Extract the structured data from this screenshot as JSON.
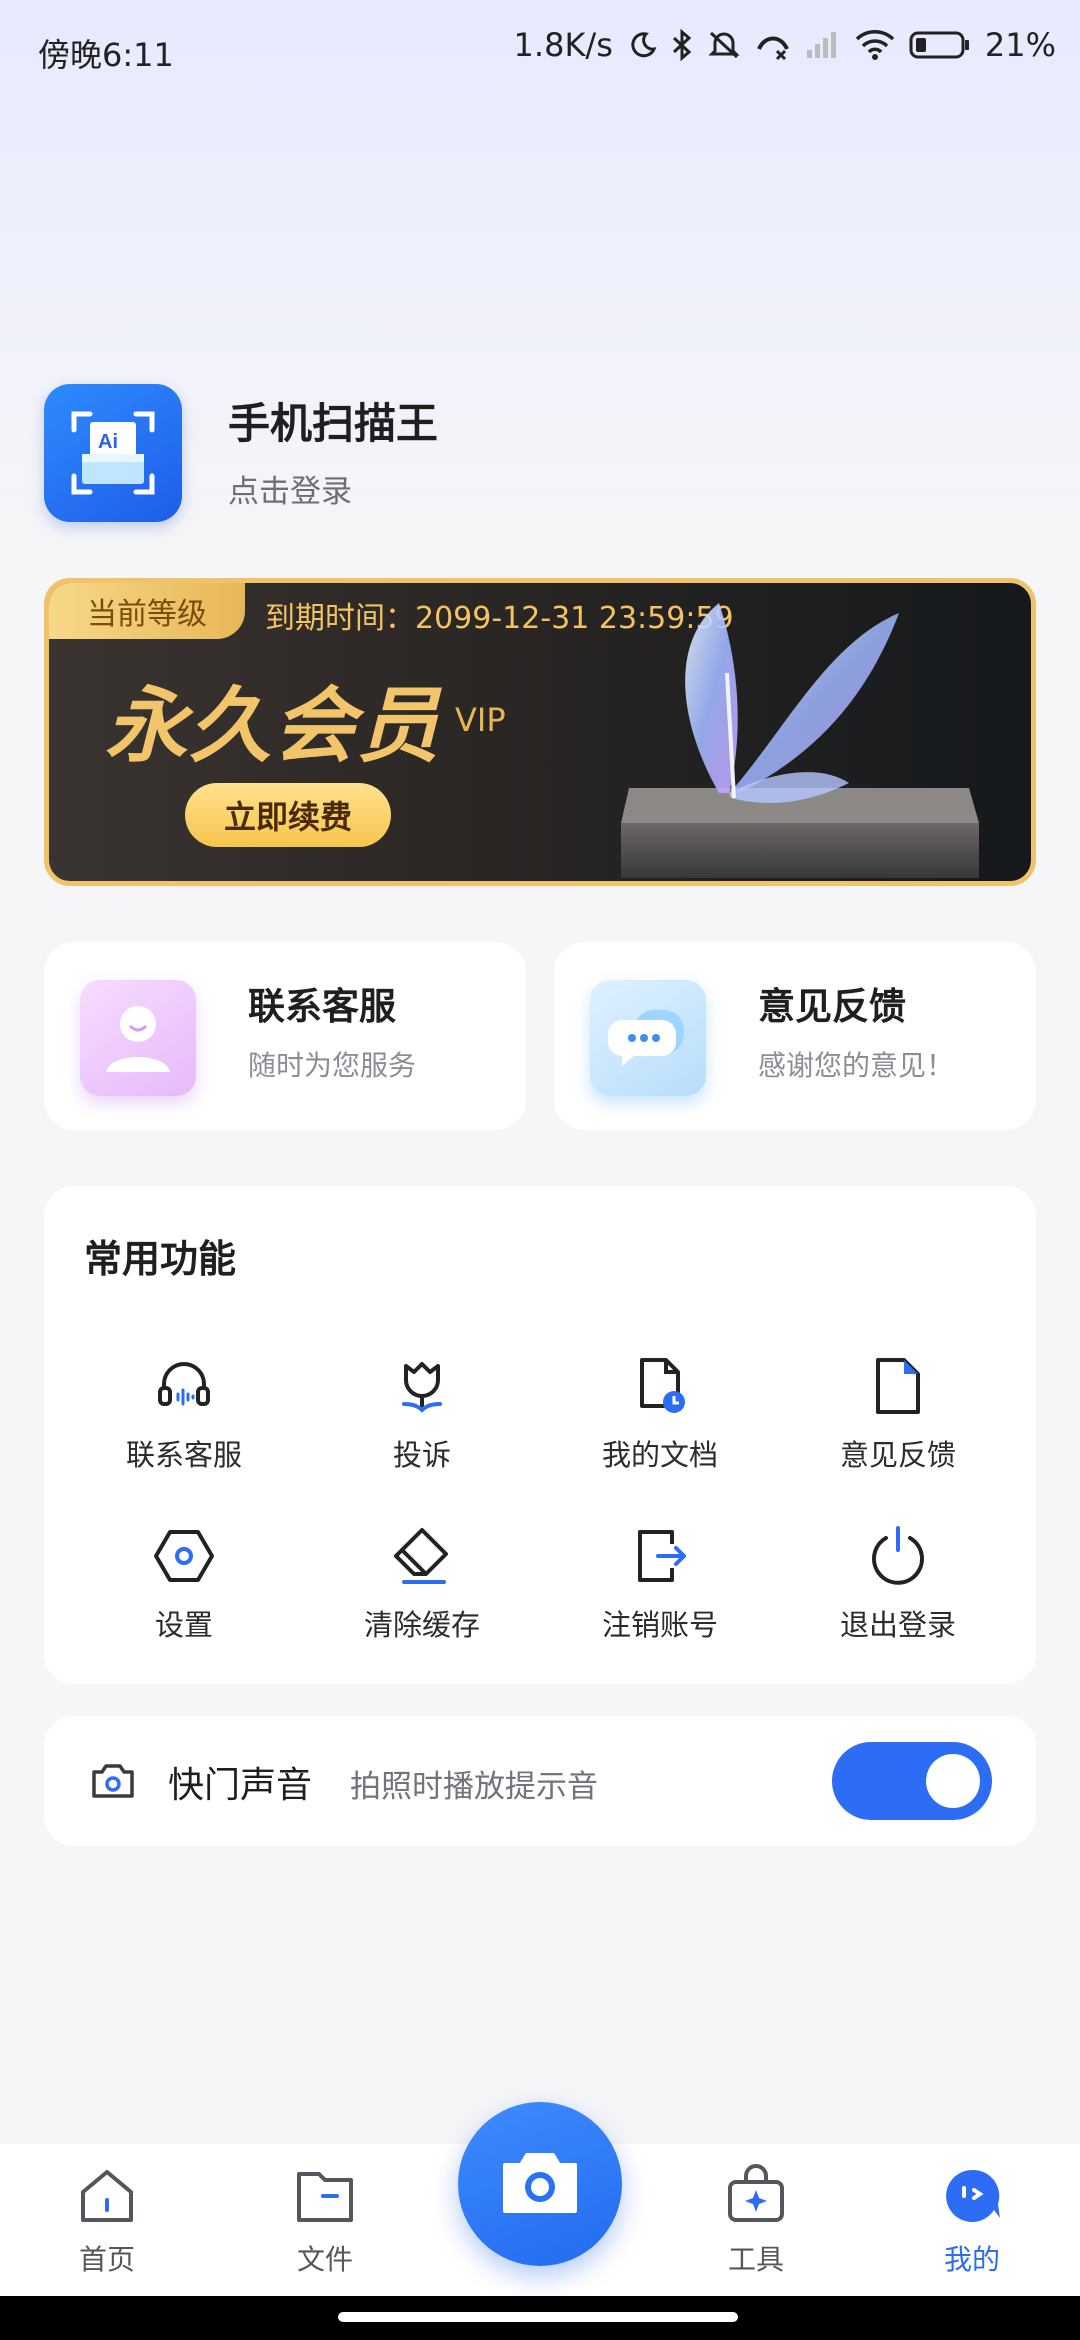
{
  "status_bar": {
    "time": "傍晚6:11",
    "network_speed": "1.8K/s",
    "battery": "21%",
    "icons": [
      "moon-icon",
      "bluetooth-icon",
      "mute-bell-icon",
      "call-icon",
      "signal-icon",
      "wifi-icon",
      "battery-icon"
    ]
  },
  "profile": {
    "app_name": "手机扫描王",
    "login_prompt": "点击登录",
    "logo_text": "Ai"
  },
  "vip_banner": {
    "tag": "当前等级",
    "expiry": "到期时间：2099-12-31 23:59:59",
    "title": "永久会员",
    "suffix": "VIP",
    "button": "立即续费"
  },
  "quick_cards": [
    {
      "title": "联系客服",
      "subtitle": "随时为您服务",
      "icon": "customer-service-avatar-icon"
    },
    {
      "title": "意见反馈",
      "subtitle": "感谢您的意见！",
      "icon": "chat-bubble-icon"
    }
  ],
  "common_functions": {
    "title": "常用功能",
    "items": [
      {
        "label": "联系客服",
        "icon": "headset-icon"
      },
      {
        "label": "投诉",
        "icon": "tulip-icon"
      },
      {
        "label": "我的文档",
        "icon": "document-clock-icon"
      },
      {
        "label": "意见反馈",
        "icon": "document-icon"
      },
      {
        "label": "设置",
        "icon": "settings-hexagon-icon"
      },
      {
        "label": "清除缓存",
        "icon": "eraser-icon"
      },
      {
        "label": "注销账号",
        "icon": "logout-arrow-icon"
      },
      {
        "label": "退出登录",
        "icon": "power-icon"
      }
    ]
  },
  "shutter_sound": {
    "label": "快门声音",
    "description": "拍照时播放提示音",
    "enabled": true
  },
  "bottom_nav": {
    "items": [
      {
        "label": "首页",
        "icon": "home-icon",
        "active": false
      },
      {
        "label": "文件",
        "icon": "folder-icon",
        "active": false
      },
      {
        "label": "工具",
        "icon": "toolbox-icon",
        "active": false
      },
      {
        "label": "我的",
        "icon": "profile-face-icon",
        "active": true
      }
    ],
    "camera_button": "camera-icon"
  },
  "colors": {
    "accent": "#2d6df6",
    "vip_gold": "#f2c56a",
    "background": "#f6f6f8"
  }
}
